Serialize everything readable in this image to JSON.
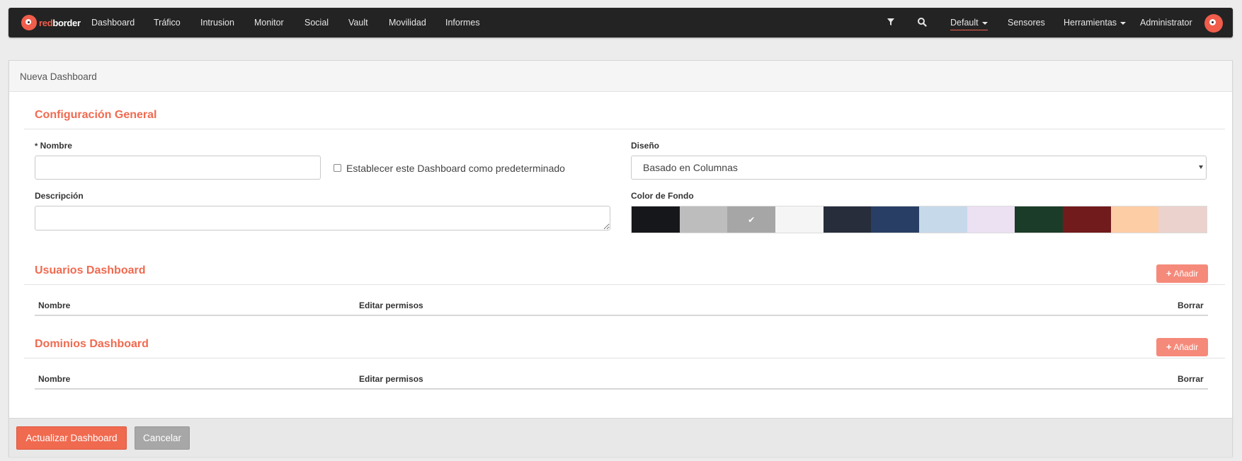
{
  "navbar": {
    "brand": {
      "red": "red",
      "white": "border"
    },
    "items": [
      "Dashboard",
      "Tráfico",
      "Intrusion",
      "Monitor",
      "Social",
      "Vault",
      "Movilidad",
      "Informes"
    ],
    "right": {
      "filter_icon": "filter-icon",
      "search_icon": "search-icon",
      "dashboard_selector": "Default",
      "sensors": "Sensores",
      "tools": "Herramientas",
      "user": "Administrator"
    }
  },
  "panel": {
    "title": "Nueva Dashboard",
    "general": {
      "title": "Configuración General",
      "name_required_mark": "*",
      "name_label": "Nombre",
      "name_value": "",
      "default_checkbox_label": "Establecer este Dashboard como predeterminado",
      "default_checked": false,
      "description_label": "Descripción",
      "description_value": "",
      "design_label": "Diseño",
      "design_value": "Basado en Columnas",
      "bg_color_label": "Color de Fondo",
      "bg_colors": [
        "#15171a",
        "#bdbdbd",
        "#a6a6a6",
        "#f5f5f5",
        "#272d3b",
        "#283e64",
        "#c6d9ea",
        "#ece0f3",
        "#1b3c28",
        "#711b1d",
        "#fdcda6",
        "#ecd2cc"
      ],
      "selected_color_index": 2
    },
    "users": {
      "title": "Usuarios Dashboard",
      "add_label": "Añadir",
      "columns": [
        "Nombre",
        "Editar permisos",
        "Borrar"
      ]
    },
    "domains": {
      "title": "Dominios Dashboard",
      "add_label": "Añadir",
      "columns": [
        "Nombre",
        "Editar permisos",
        "Borrar"
      ]
    },
    "footer": {
      "update_label": "Actualizar Dashboard",
      "cancel_label": "Cancelar"
    }
  }
}
